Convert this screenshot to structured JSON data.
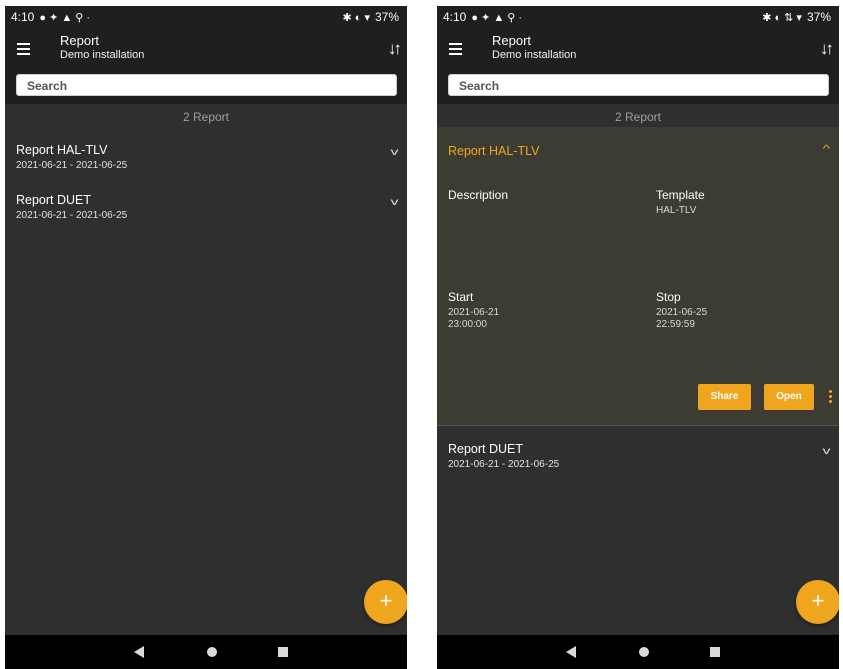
{
  "status": {
    "time": "4:10",
    "battery_left": "37%",
    "battery_right": "37%"
  },
  "appbar": {
    "title": "Report",
    "subtitle": "Demo installation"
  },
  "search": {
    "placeholder": "Search"
  },
  "list": {
    "count_label": "2 Report",
    "items": [
      {
        "title": "Report HAL-TLV",
        "dates": "2021-06-21 - 2021-06-25"
      },
      {
        "title": "Report DUET",
        "dates": "2021-06-21 - 2021-06-25"
      }
    ]
  },
  "detail": {
    "title": "Report HAL-TLV",
    "description_label": "Description",
    "template_label": "Template",
    "template_value": "HAL-TLV",
    "start_label": "Start",
    "start_date": "2021-06-21",
    "start_time": "23:00:00",
    "stop_label": "Stop",
    "stop_date": "2021-06-25",
    "stop_time": "22:59:59",
    "share_label": "Share",
    "open_label": "Open"
  },
  "fab": {
    "label": "+"
  },
  "colors": {
    "accent": "#f0a51e",
    "background": "#2f2f2f",
    "appbar": "#1f1f1f",
    "expanded_bg": "#3d3c33"
  },
  "icons": [
    "menu-icon",
    "sort-icon",
    "chevron-down-icon",
    "chevron-up-icon",
    "more-vert-icon",
    "add-icon",
    "back-icon",
    "home-icon",
    "recents-icon"
  ]
}
